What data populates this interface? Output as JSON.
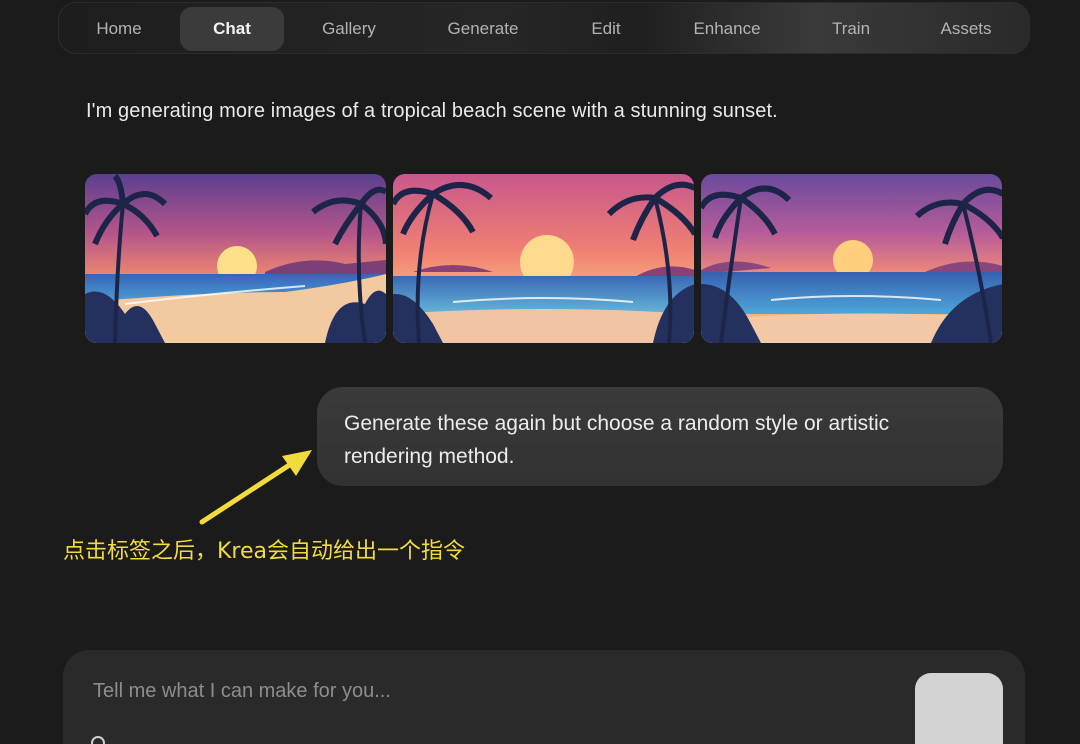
{
  "nav": {
    "tabs": [
      {
        "label": "Home",
        "active": false
      },
      {
        "label": "Chat",
        "active": true
      },
      {
        "label": "Gallery",
        "active": false
      },
      {
        "label": "Generate",
        "active": false
      },
      {
        "label": "Edit",
        "active": false
      },
      {
        "label": "Enhance",
        "active": false
      },
      {
        "label": "Train",
        "active": false
      },
      {
        "label": "Assets",
        "active": false
      }
    ]
  },
  "chat": {
    "assistant_message": "I'm generating more images of a tropical beach scene with a stunning sunset.",
    "images": [
      {
        "name": "beach-sunset-image-1"
      },
      {
        "name": "beach-sunset-image-2"
      },
      {
        "name": "beach-sunset-image-3"
      }
    ],
    "user_message": "Generate these again but choose a random style or artistic rendering method."
  },
  "annotation": {
    "text": "点击标签之后，Krea会自动给出一个指令",
    "color": "#f2dc3c"
  },
  "composer": {
    "placeholder": "Tell me what I can make for you..."
  },
  "colors": {
    "background": "#1b1b1b",
    "bubble": "#353535",
    "active_tab": "#3b3b3b",
    "send_button": "#d3d3d3"
  }
}
